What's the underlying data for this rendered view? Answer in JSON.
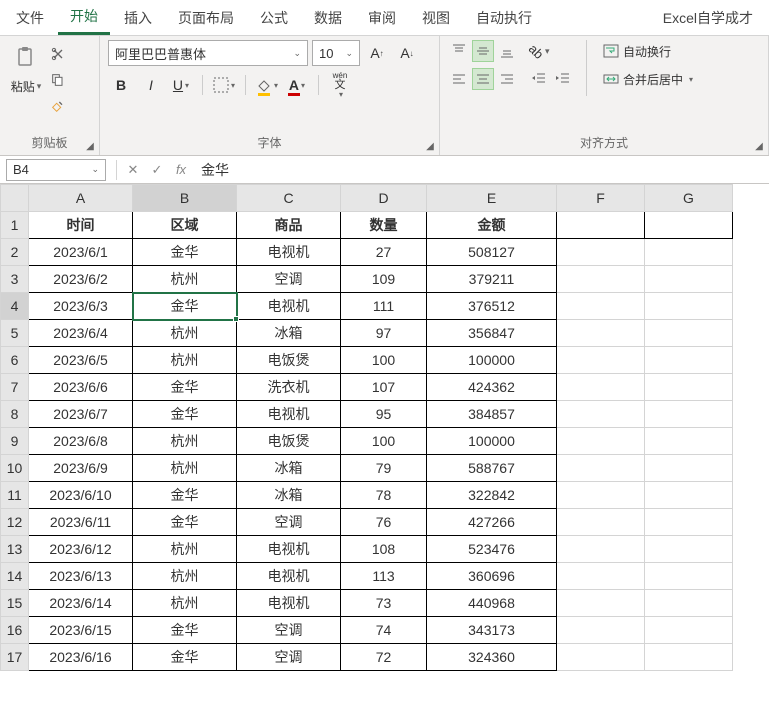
{
  "menu": {
    "items": [
      "文件",
      "开始",
      "插入",
      "页面布局",
      "公式",
      "数据",
      "审阅",
      "视图",
      "自动执行"
    ],
    "active": 1,
    "right": "Excel自学成才"
  },
  "ribbon": {
    "clipboard": {
      "paste": "粘贴",
      "label": "剪贴板"
    },
    "font": {
      "name": "阿里巴巴普惠体",
      "size": "10",
      "wen": "wén",
      "wen_sub": "文",
      "label": "字体"
    },
    "align": {
      "wrap": "自动换行",
      "merge": "合并后居中",
      "label": "对齐方式"
    }
  },
  "formula_bar": {
    "name_box": "B4",
    "fx": "fx",
    "value": "金华"
  },
  "grid": {
    "cols": [
      "A",
      "B",
      "C",
      "D",
      "E",
      "F",
      "G"
    ],
    "selected_col": 1,
    "selected_row": 3,
    "headers": [
      "时间",
      "区域",
      "商品",
      "数量",
      "金额"
    ],
    "rows": [
      [
        "2023/6/1",
        "金华",
        "电视机",
        "27",
        "508127"
      ],
      [
        "2023/6/2",
        "杭州",
        "空调",
        "109",
        "379211"
      ],
      [
        "2023/6/3",
        "金华",
        "电视机",
        "111",
        "376512"
      ],
      [
        "2023/6/4",
        "杭州",
        "冰箱",
        "97",
        "356847"
      ],
      [
        "2023/6/5",
        "杭州",
        "电饭煲",
        "100",
        "100000"
      ],
      [
        "2023/6/6",
        "金华",
        "洗衣机",
        "107",
        "424362"
      ],
      [
        "2023/6/7",
        "金华",
        "电视机",
        "95",
        "384857"
      ],
      [
        "2023/6/8",
        "杭州",
        "电饭煲",
        "100",
        "100000"
      ],
      [
        "2023/6/9",
        "杭州",
        "冰箱",
        "79",
        "588767"
      ],
      [
        "2023/6/10",
        "金华",
        "冰箱",
        "78",
        "322842"
      ],
      [
        "2023/6/11",
        "金华",
        "空调",
        "76",
        "427266"
      ],
      [
        "2023/6/12",
        "杭州",
        "电视机",
        "108",
        "523476"
      ],
      [
        "2023/6/13",
        "杭州",
        "电视机",
        "113",
        "360696"
      ],
      [
        "2023/6/14",
        "杭州",
        "电视机",
        "73",
        "440968"
      ],
      [
        "2023/6/15",
        "金华",
        "空调",
        "74",
        "343173"
      ],
      [
        "2023/6/16",
        "金华",
        "空调",
        "72",
        "324360"
      ]
    ]
  }
}
